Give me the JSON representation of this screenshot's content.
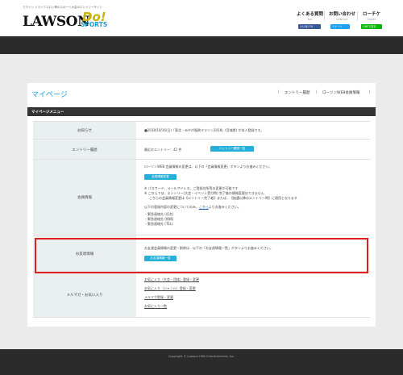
{
  "header": {
    "tagline": "マラソン トライアスロン等のスポーツ大会のエントリーサイト",
    "logo_main": "LAWSON",
    "logo_do": "Do!",
    "logo_sports": "SPORTS",
    "nav": [
      {
        "jp": "よくある質問",
        "en": "FAQ"
      },
      {
        "jp": "お問い合わせ",
        "en": "CONTACT"
      },
      {
        "jp": "ローチケ",
        "en": "TICKET"
      }
    ],
    "share": [
      {
        "label": "いいね! 10",
        "color": "#3b5998"
      },
      {
        "label": "ツイート",
        "color": "#1da1f2"
      },
      {
        "label": "LINEで送る",
        "color": "#00b900"
      }
    ]
  },
  "page": {
    "title": "マイページ",
    "top_nav": [
      "エントリー履歴",
      "ローソンWEB会員情報"
    ],
    "menu_header": "マイページメニュー"
  },
  "rows": {
    "notice": {
      "label": "お知らせ",
      "text": "■2018/10/16(日)「東北・みやぎ復興マラソン2018」(宮城県) が本人登録です。"
    },
    "history": {
      "label": "エントリー履歴",
      "text": "最近のエントリー：42 件",
      "button": "エントリー履歴一覧"
    },
    "member": {
      "label": "会員情報",
      "intro": "ローソンWEB 会員情報の変更は、以下の「会員情報変更」ボタンよりお進みください。",
      "button": "会員情報変更",
      "notes": [
        "※ パスワード、メールアドレス、ご登録住所等の変更が可能です",
        "※ こちらでは、エントリー(大会・イベント受付時) 完了後の情報変更はできません",
        "こちらの会員情報変更は【エントリー完了者】または、【抽選以降のエントリー時】に適用となります"
      ],
      "emergency_intro": "以下の登録内容の変更についてのみ、",
      "emergency_link": "こちら",
      "emergency_tail": "よりお進みください。",
      "emergency_items": [
        "・緊急連絡先 (氏名)",
        "・緊急連絡先 (続柄)",
        "・緊急連絡先 (TEL)"
      ]
    },
    "friend": {
      "label": "お友達情報",
      "text": "お友達会員情報の変更・削除は、以下の「お友達情報一覧」ボタンよりお進みください。",
      "button": "お友達情報一覧"
    },
    "mail": {
      "label": "メルマガ・お気に入り",
      "links": [
        "お気に入り（大会・団体）登録・変更",
        "お気に入り（ジャンル）登録・変更",
        "メルマガ登録・変更",
        "お気に入り一覧"
      ]
    }
  },
  "footer": {
    "copyright": "Copyright © Lawson HMV Entertainment, Inc."
  }
}
